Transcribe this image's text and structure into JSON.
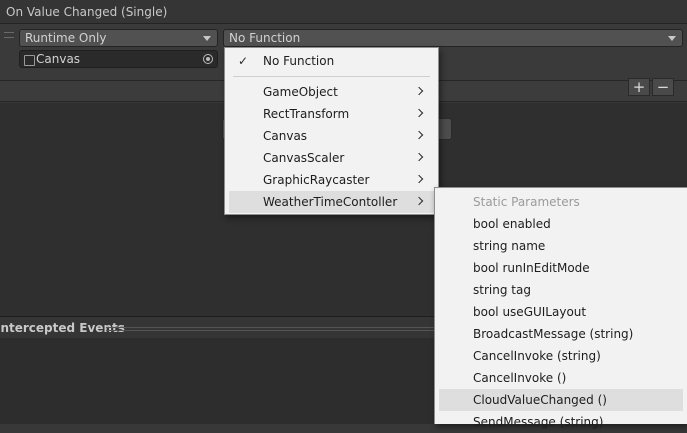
{
  "event": {
    "title": "On Value Changed (Single)"
  },
  "listener": {
    "runtime_mode": "Runtime Only",
    "function": "No Function",
    "target_object": "Canvas"
  },
  "list_controls": {
    "add": "+",
    "remove": "−"
  },
  "section": {
    "title": "Intercepted Events"
  },
  "function_menu": {
    "selected": "No Function",
    "items": [
      "GameObject",
      "RectTransform",
      "Canvas",
      "CanvasScaler",
      "GraphicRaycaster",
      "WeatherTimeContoller"
    ]
  },
  "submenu": {
    "header": "Static Parameters",
    "items": [
      "bool enabled",
      "string name",
      "bool runInEditMode",
      "string tag",
      "bool useGUILayout",
      "BroadcastMessage (string)",
      "CancelInvoke (string)",
      "CancelInvoke ()",
      "CloudValueChanged ()",
      "SendMessage (string)"
    ]
  }
}
